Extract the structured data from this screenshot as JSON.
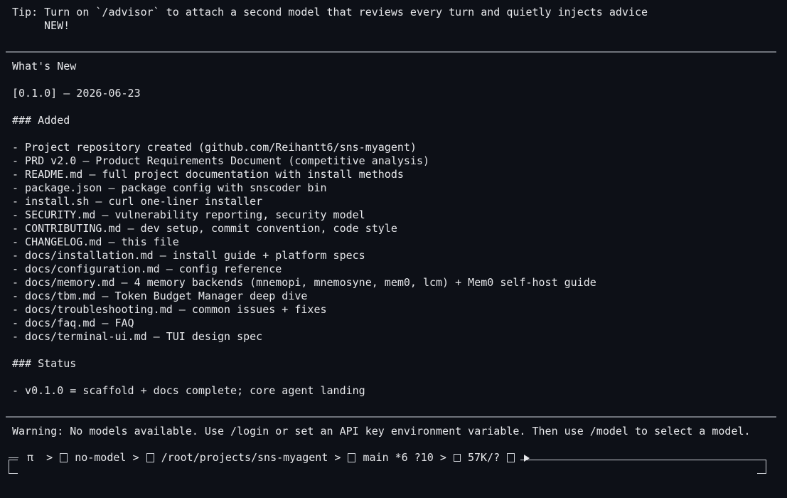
{
  "tip": {
    "text": "Tip: Turn on `/advisor` to attach a second model that reviews every turn and quietly injects advice",
    "badge": "NEW!"
  },
  "whats_new": {
    "title": "What's New",
    "version_line": "[0.1.0] — 2026-06-23",
    "added_heading": "### Added",
    "added_items": [
      "- Project repository created (github.com/Reihantt6/sns-myagent)",
      "- PRD v2.0 — Product Requirements Document (competitive analysis)",
      "- README.md — full project documentation with install methods",
      "- package.json — package config with snscoder bin",
      "- install.sh — curl one-liner installer",
      "- SECURITY.md — vulnerability reporting, security model",
      "- CONTRIBUTING.md — dev setup, commit convention, code style",
      "- CHANGELOG.md — this file",
      "- docs/installation.md — install guide + platform specs",
      "- docs/configuration.md — config reference",
      "- docs/memory.md — 4 memory backends (mnemopi, mnemosyne, mem0, lcm) + Mem0 self-host guide",
      "- docs/tbm.md — Token Budget Manager deep dive",
      "- docs/troubleshooting.md — common issues + fixes",
      "- docs/faq.md — FAQ",
      "- docs/terminal-ui.md — TUI design spec"
    ],
    "status_heading": "### Status",
    "status_items": [
      "- v0.1.0 = scaffold + docs complete; core agent landing"
    ]
  },
  "warning": "Warning: No models available. Use /login or set an API key environment variable. Then use /model to select a model.",
  "statusbar": {
    "prompt_symbol": "π",
    "sep": ">",
    "model": "no-model",
    "path": "/root/projects/sns-myagent",
    "branch": "main *6 ?10",
    "tokens": "57K/?",
    "icons": {
      "model": "model-icon",
      "folder": "folder-icon",
      "branch": "git-branch-icon",
      "tokens": "token-meter-icon",
      "play": "play-icon"
    }
  }
}
